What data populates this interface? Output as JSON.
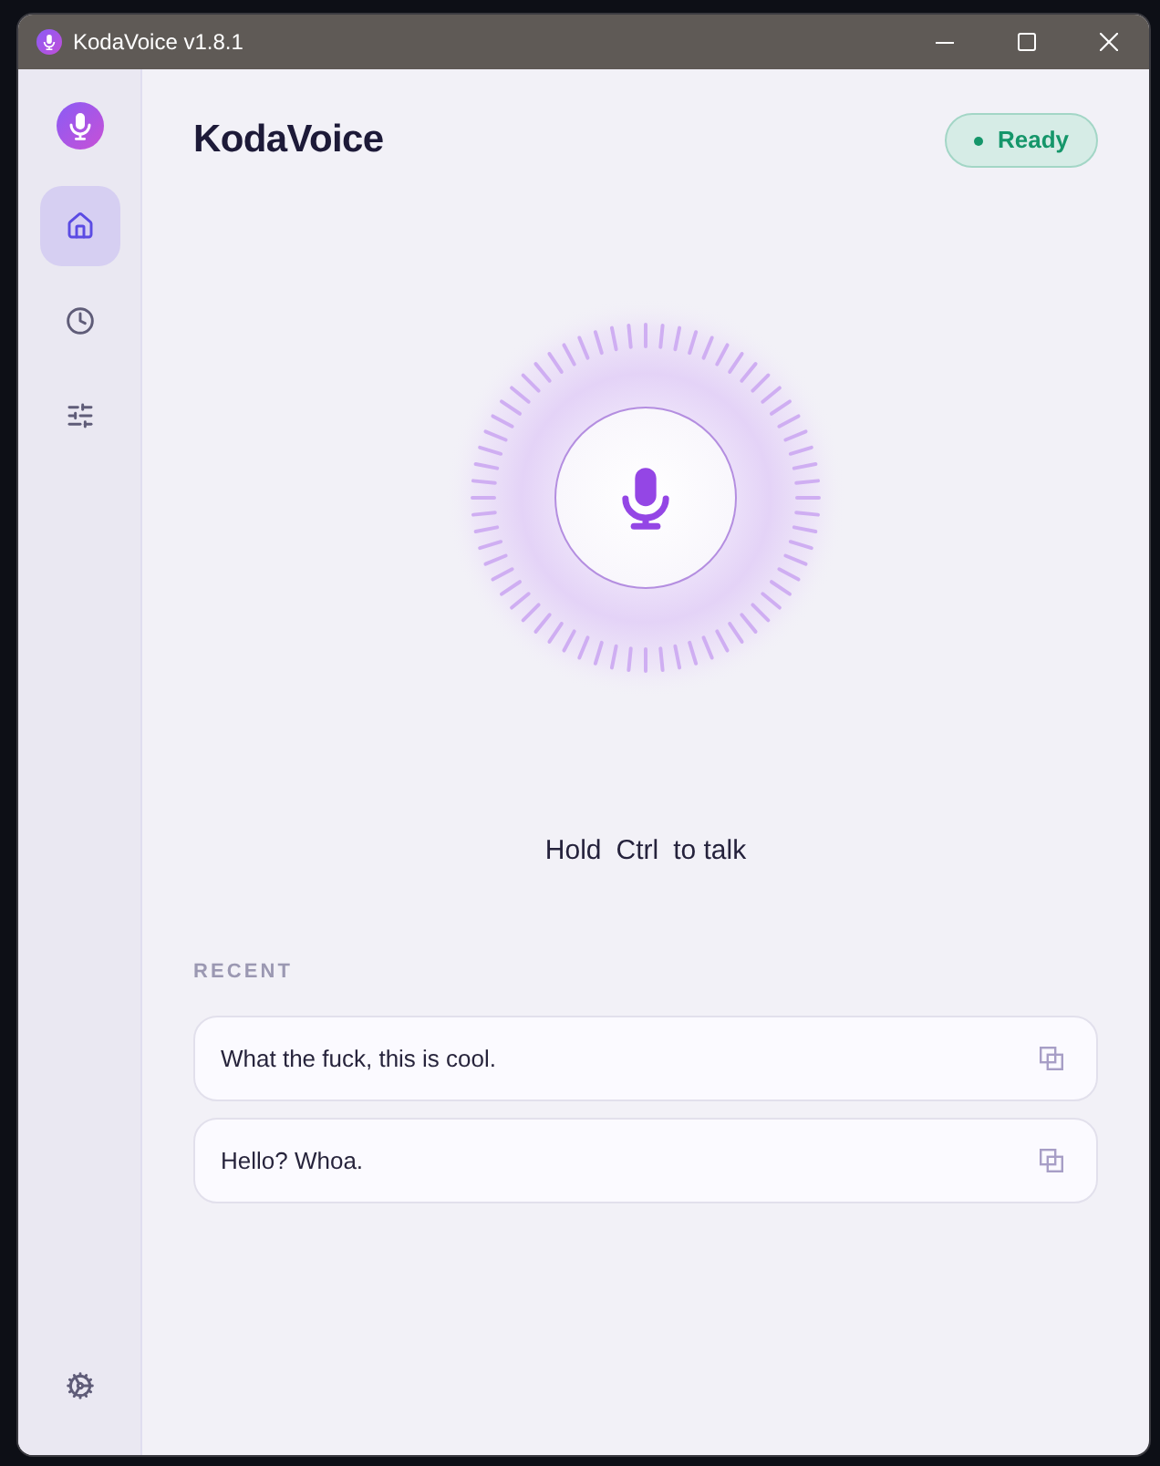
{
  "window": {
    "title": "KodaVoice v1.8.1"
  },
  "sidebar": {
    "items": [
      {
        "kind": "home",
        "selected": true
      },
      {
        "kind": "history",
        "selected": false
      },
      {
        "kind": "sliders",
        "selected": false
      }
    ]
  },
  "header": {
    "title": "KodaVoice",
    "status": {
      "label": "Ready",
      "kind": "ready"
    }
  },
  "hint": {
    "before": "Hold",
    "key": "Ctrl",
    "after": "to talk"
  },
  "recent": {
    "heading": "RECENT",
    "items": [
      {
        "text": "What the fuck, this is cool."
      },
      {
        "text": "Hello? Whoa."
      }
    ]
  }
}
